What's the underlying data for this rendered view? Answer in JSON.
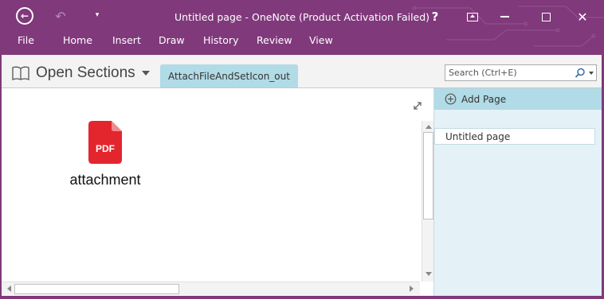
{
  "window": {
    "title": "Untitled page - OneNote (Product Activation Failed)",
    "help": "?",
    "close": "✕"
  },
  "ribbon": {
    "tabs": [
      {
        "label": "File"
      },
      {
        "label": "Home"
      },
      {
        "label": "Insert"
      },
      {
        "label": "Draw"
      },
      {
        "label": "History"
      },
      {
        "label": "Review"
      },
      {
        "label": "View"
      }
    ]
  },
  "navigation": {
    "notebook_label": "Open Sections",
    "section_tab": "AttachFileAndSetIcon_out",
    "search_placeholder": "Search (Ctrl+E)"
  },
  "page": {
    "attachment_name": "attachment",
    "attachment_icon_label": "PDF"
  },
  "page_panel": {
    "add_page_label": "Add Page",
    "pages": [
      {
        "title": "Untitled page"
      }
    ]
  },
  "colors": {
    "accent": "#80397b",
    "section_tab": "#b1dbe6",
    "page_panel": "#e4f1f7",
    "pdf_icon": "#e3262e"
  },
  "icons": {
    "back": "back-arrow-icon",
    "undo": "undo-icon",
    "qat": "customize-toolbar-icon",
    "search": "search-icon",
    "expand": "expand-icon",
    "add_page": "add-page-icon",
    "attachment": "pdf-file-icon"
  }
}
